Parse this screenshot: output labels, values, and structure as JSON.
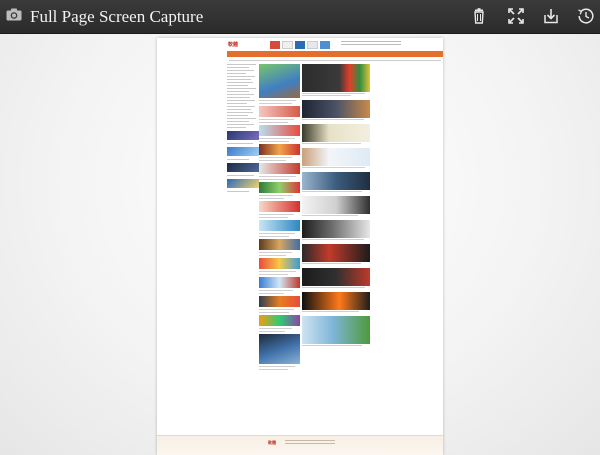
{
  "app": {
    "title": "Full Page Screen Capture",
    "toolbar": [
      {
        "name": "delete-button",
        "icon": "trash-icon"
      },
      {
        "name": "fit-button",
        "icon": "expand-icon"
      },
      {
        "name": "download-button",
        "icon": "download-icon"
      },
      {
        "name": "history-button",
        "icon": "history-icon"
      }
    ],
    "colors": {
      "toolbar": "#2f2f2f",
      "accent": "#e46e2b",
      "brand": "#c0392b"
    }
  },
  "capture": {
    "logo": "軟體"
  }
}
